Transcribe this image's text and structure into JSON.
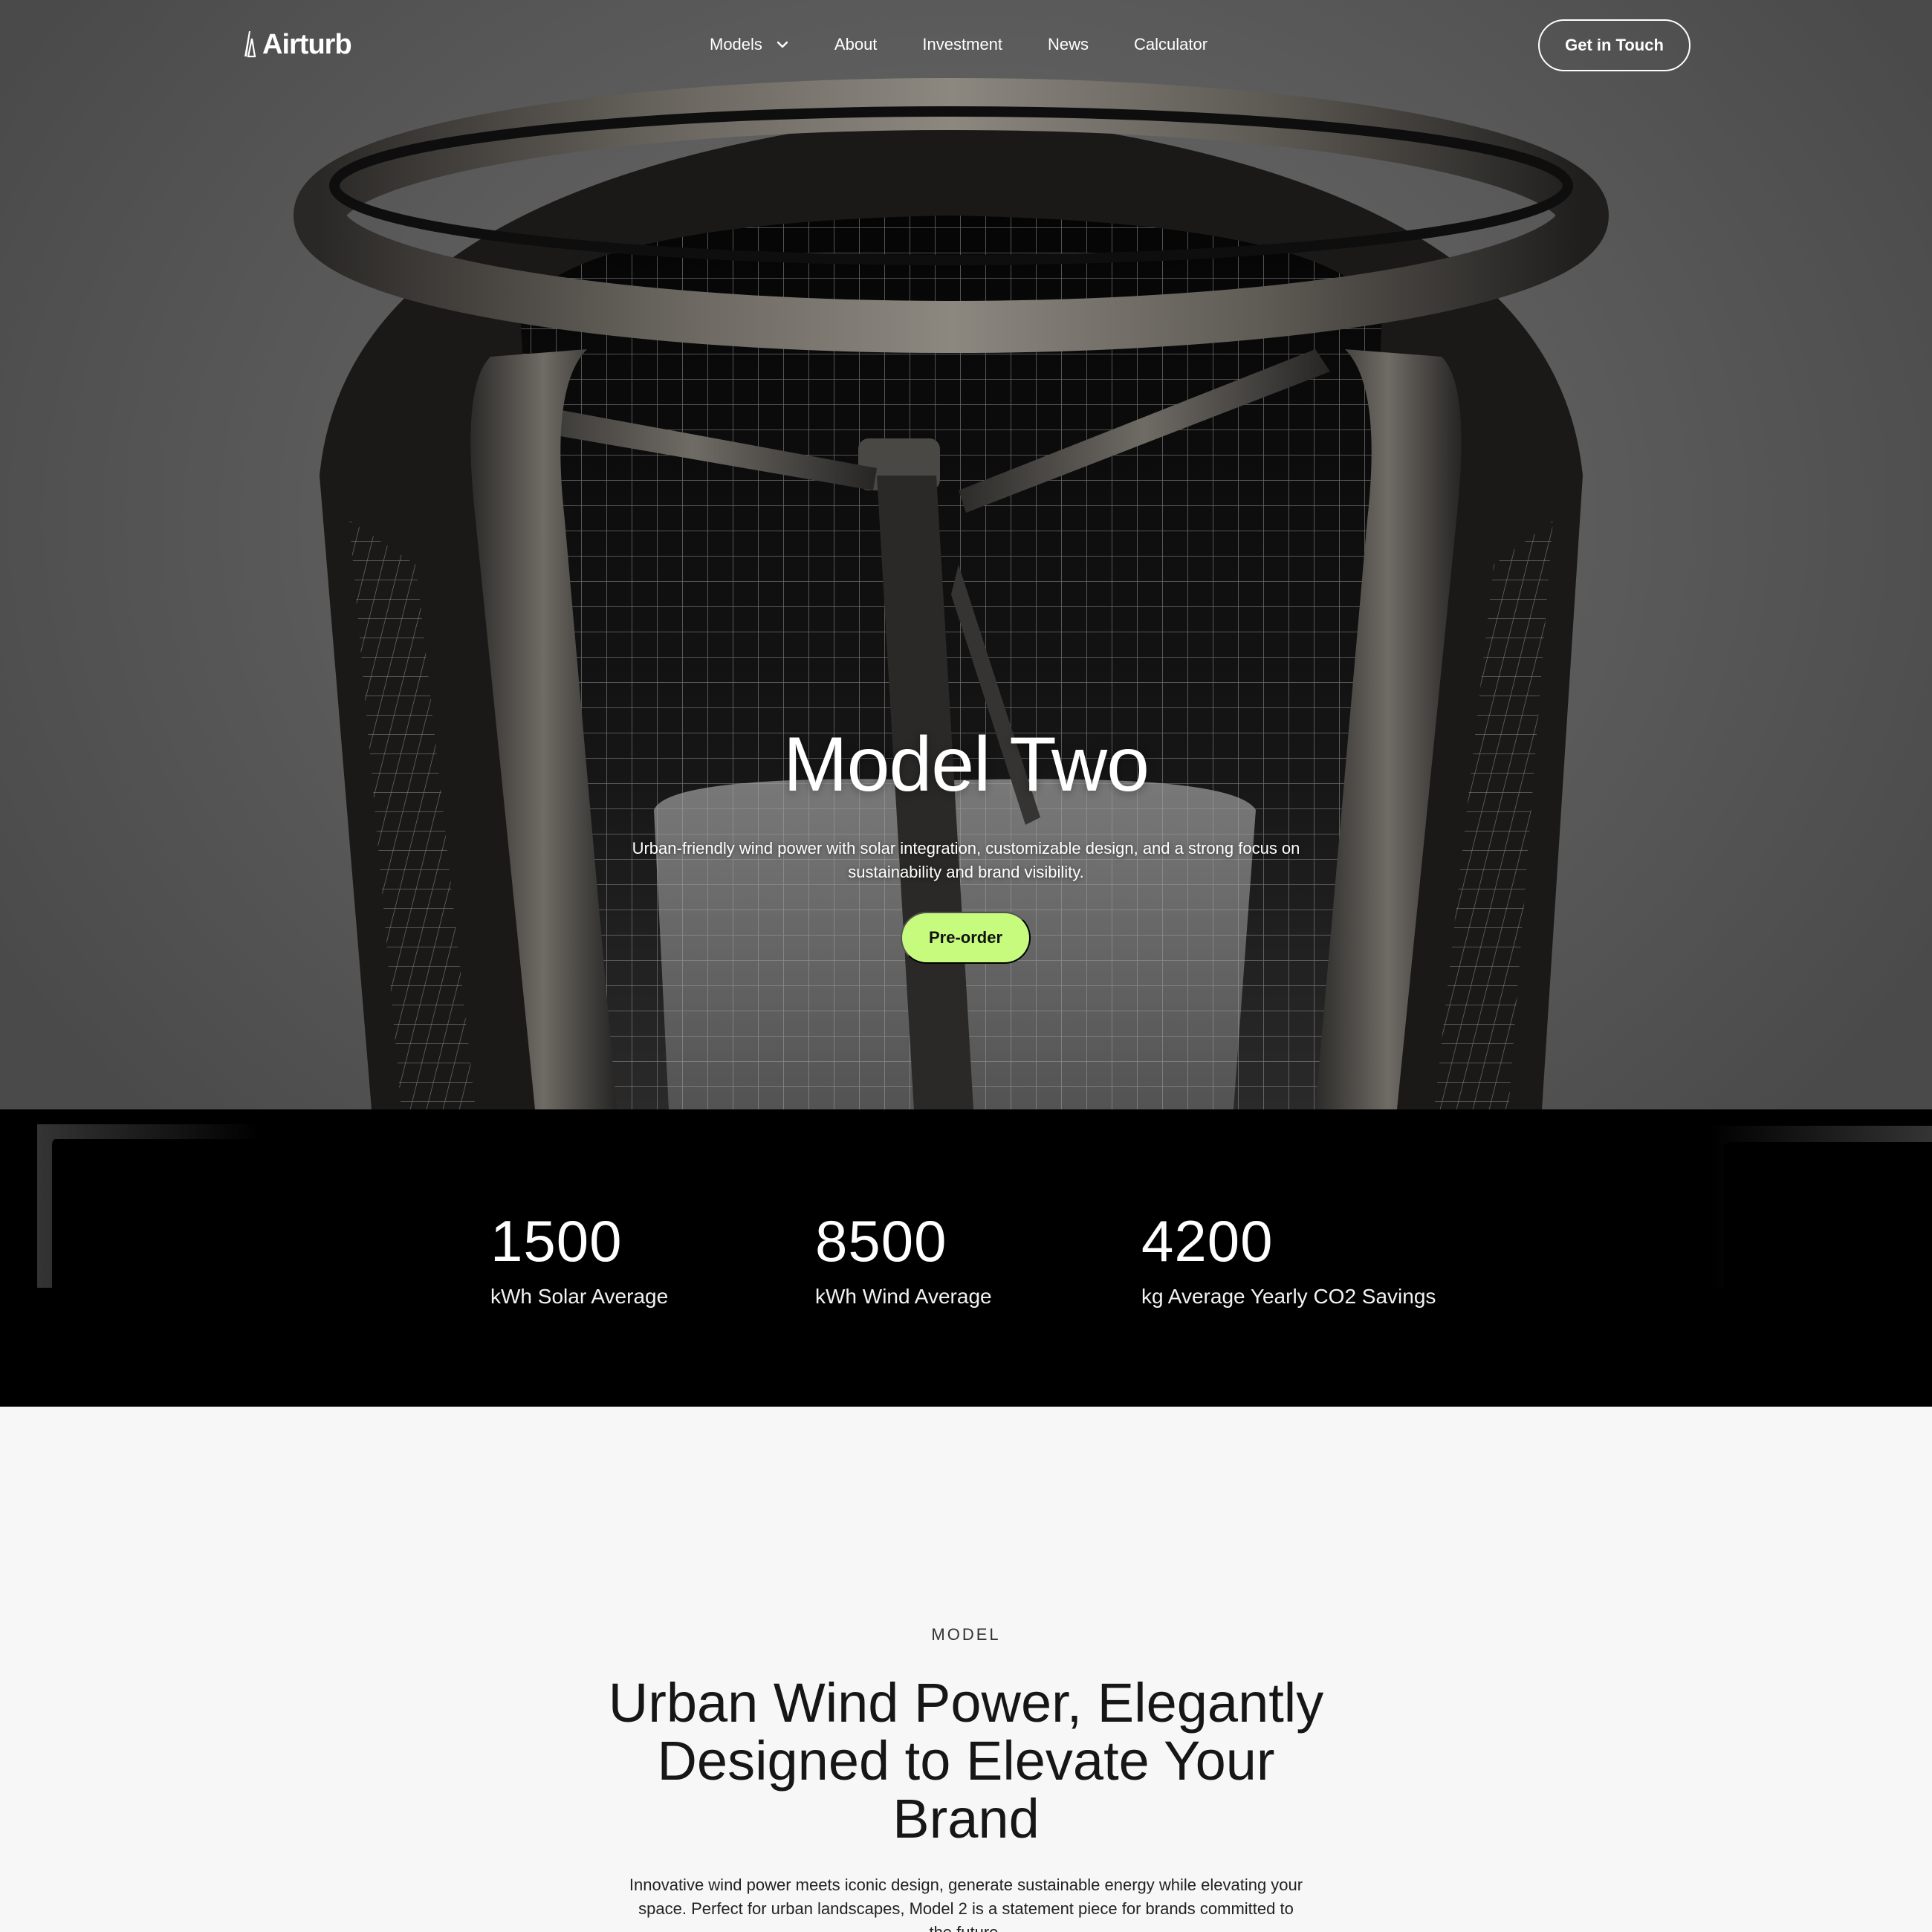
{
  "brand": {
    "name": "Airturb"
  },
  "nav": {
    "items": [
      {
        "label": "Models",
        "has_dropdown": true
      },
      {
        "label": "About"
      },
      {
        "label": "Investment"
      },
      {
        "label": "News"
      },
      {
        "label": "Calculator"
      }
    ],
    "cta_label": "Get in Touch"
  },
  "hero": {
    "title": "Model Two",
    "subtitle": "Urban-friendly wind power with solar integration, customizable design, and a strong focus on sustainability and brand visibility.",
    "cta_label": "Pre-order"
  },
  "stats": [
    {
      "value": "1500",
      "label": "kWh Solar Average"
    },
    {
      "value": "8500",
      "label": "kWh Wind Average"
    },
    {
      "value": "4200",
      "label": "kg Average Yearly CO2 Savings"
    }
  ],
  "model_section": {
    "eyebrow": "MODEL",
    "title": "Urban Wind Power, Elegantly Designed to Elevate Your Brand",
    "body": "Innovative wind power meets iconic design, generate sustainable energy while elevating your space. Perfect for urban landscapes, Model 2 is a statement piece for brands committed to the future."
  },
  "colors": {
    "accent": "#c6fb7d",
    "hero_bg": "#5f5f5f",
    "stats_bg": "#000000",
    "section_bg": "#f7f7f7"
  },
  "icons": {
    "logo": "turbine-logo-icon",
    "dropdown": "chevron-down-icon"
  }
}
